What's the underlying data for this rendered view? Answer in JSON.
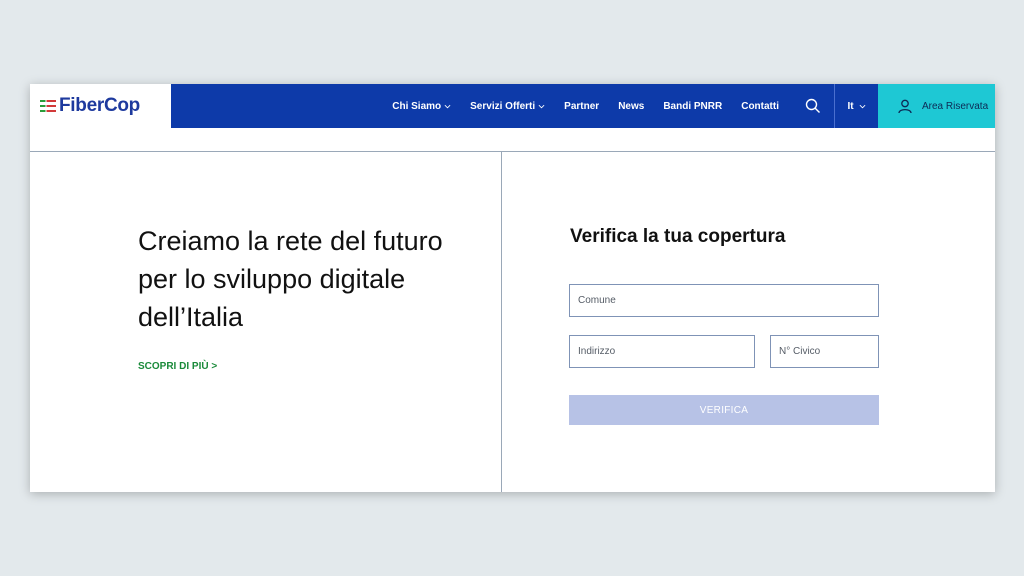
{
  "header": {
    "logo_text": "FiberCop",
    "nav": {
      "about": "Chi Siamo",
      "services": "Servizi Offerti",
      "partner": "Partner",
      "news": "News",
      "pnrr": "Bandi PNRR",
      "contacts": "Contatti"
    },
    "language": "It",
    "reserved_area": "Area Riservata",
    "icons": [
      "search-icon",
      "user-icon",
      "chevron-down-icon"
    ],
    "colors": {
      "nav_bg": "#0d3aa9",
      "reserved_bg": "#1ec8d4",
      "brand": "#1e3a9e"
    }
  },
  "hero": {
    "headline": "Creiamo la rete del futuro per lo sviluppo digitale dell’Italia",
    "more_link": "SCOPRI DI PIÙ >"
  },
  "coverage_form": {
    "title": "Verifica la tua copertura",
    "comune_placeholder": "Comune",
    "indirizzo_placeholder": "Indirizzo",
    "civico_placeholder": "N° Civico",
    "submit_label": "VERIFICA"
  }
}
